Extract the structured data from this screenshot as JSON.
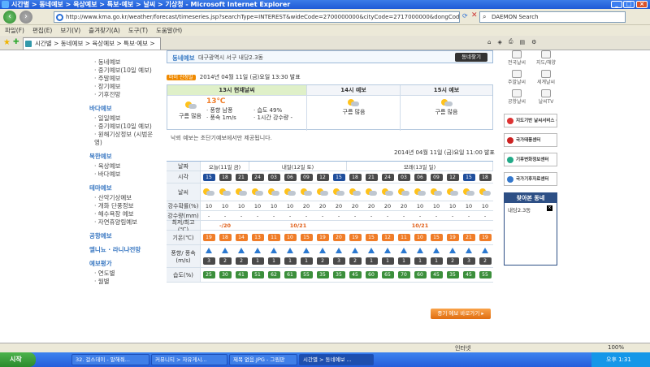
{
  "window": {
    "title": "시간별 > 동네예보 > 육상예보 > 특보·예보 > 날씨 > 기상청 - Microsoft Internet Explorer"
  },
  "address": {
    "url": "http://www.kma.go.kr/weather/forecast/timeseries.jsp?searchType=INTEREST&wideCode=2700000000&cityCode=2717000000&dongCode=271",
    "search_placeholder": "DAEMON Search"
  },
  "menu": [
    "파일(F)",
    "편집(E)",
    "보기(V)",
    "즐겨찾기(A)",
    "도구(T)",
    "도움말(H)"
  ],
  "tab": {
    "label": "시간별 > 동네예보 > 육상예보 > 특보·예보 > ..."
  },
  "leftnav": {
    "groups": [
      {
        "head": "",
        "items": [
          "동네예보",
          "중기예보(10일 예보)",
          "주말예보",
          "장기예보",
          "기후전망"
        ]
      },
      {
        "head": "바다예보",
        "items": [
          "일일예보",
          "중기예보(10일 예보)",
          "원해기상정보 (시범운영)"
        ]
      },
      {
        "head": "북한예보",
        "items": [
          "육상예보",
          "바다예보"
        ]
      },
      {
        "head": "테마예보",
        "items": [
          "산악기상예보",
          "개화 단풍정보",
          "해수욕장 예보",
          "자연휴양림예보"
        ]
      },
      {
        "head": "공항예보",
        "items": []
      },
      {
        "head": "엘니뇨 · 라니냐전망",
        "items": []
      },
      {
        "head": "예보평가",
        "items": [
          "연도별",
          "월별"
        ]
      }
    ]
  },
  "main": {
    "box_label": "동네예보",
    "address_text": "대구광역시 서구 내당2.3동",
    "find_btn": "동네찾기",
    "announce_tag": "마이 신청일",
    "announce": "2014년 04월 11일 (금)요일 13:30 발표",
    "forecast3": [
      {
        "head": "13시 현재날씨",
        "sky": "구름 많음",
        "temp": "13℃",
        "wind": "· 풍향 남풍",
        "windspeed": "· 풍속 1m/s",
        "humidity": "· 습도 49%",
        "rain": "· 1시간 강수량 -"
      },
      {
        "head": "14시 예보",
        "sky": "구름 많음"
      },
      {
        "head": "15시 예보",
        "sky": "구름 많음"
      }
    ],
    "note": "낙뢰 예보는 초단기예보에서만 제공됩니다.",
    "announce2": "2014년 04월 11일 (금)요일 11:00 발표",
    "labels": {
      "date": "날짜",
      "hour": "시각",
      "weather": "날씨",
      "rainprob": "강수확률(%)",
      "rainamt": "강수량(mm)",
      "minmax": "최저/최고(℃)",
      "temp": "기온(℃)",
      "wind": "풍향/ 풍속(m/s)",
      "humidity": "습도(%)"
    },
    "days": [
      "오늘(11일 금)",
      "내일(12일 토)",
      "모레(13일 일)"
    ],
    "hours": [
      "15",
      "18",
      "21",
      "24",
      "03",
      "06",
      "09",
      "12",
      "15",
      "18",
      "21",
      "24",
      "03",
      "06",
      "09",
      "12",
      "15",
      "18"
    ],
    "rainprob": [
      "10",
      "10",
      "10",
      "10",
      "10",
      "10",
      "20",
      "20",
      "20",
      "20",
      "20",
      "20",
      "20",
      "10",
      "10",
      "10",
      "10",
      "10"
    ],
    "rainamt": [
      "-",
      "-",
      "-",
      "-",
      "-",
      "-",
      "-",
      "-",
      "-",
      "-",
      "-",
      "-",
      "-",
      "-",
      "-",
      "-",
      "-",
      "-"
    ],
    "minmax": [
      "-/20",
      "10/21",
      "10/21"
    ],
    "temps": [
      "19",
      "18",
      "14",
      "13",
      "11",
      "10",
      "15",
      "19",
      "20",
      "19",
      "15",
      "12",
      "11",
      "10",
      "15",
      "19",
      "21",
      "19"
    ],
    "windspeed": [
      "3",
      "2",
      "2",
      "1",
      "1",
      "1",
      "1",
      "2",
      "3",
      "2",
      "1",
      "1",
      "1",
      "1",
      "1",
      "2",
      "3",
      "2"
    ],
    "humidity": [
      "25",
      "30",
      "41",
      "51",
      "62",
      "61",
      "55",
      "35",
      "35",
      "45",
      "60",
      "65",
      "70",
      "60",
      "45",
      "35",
      "45",
      "55"
    ],
    "more_btn": "중기 예보 바로가기 ▸"
  },
  "right": {
    "icons": [
      "전국날씨",
      "지도/해양",
      "주말날씨",
      "세계날씨",
      "공항날씨",
      "날씨TV"
    ],
    "banners": [
      "지도기반 날씨서비스 GIS Service",
      "국가태풍센터",
      "기후변화정보센터",
      "국가기후자료센터"
    ],
    "visited_head": "찾아본 동네",
    "visited_item": "내당2.3동"
  },
  "status": {
    "right": "인터넷",
    "zoom": "100%"
  },
  "taskbar": {
    "start": "시작",
    "buttons": [
      "32. 걸스데이 - 말해줘...",
      "커뮤니티 > 자유게시...",
      "제목 없음.JPG - 그림판",
      "시간별 > 동네예보 ..."
    ],
    "clock": "오후 1:31"
  }
}
